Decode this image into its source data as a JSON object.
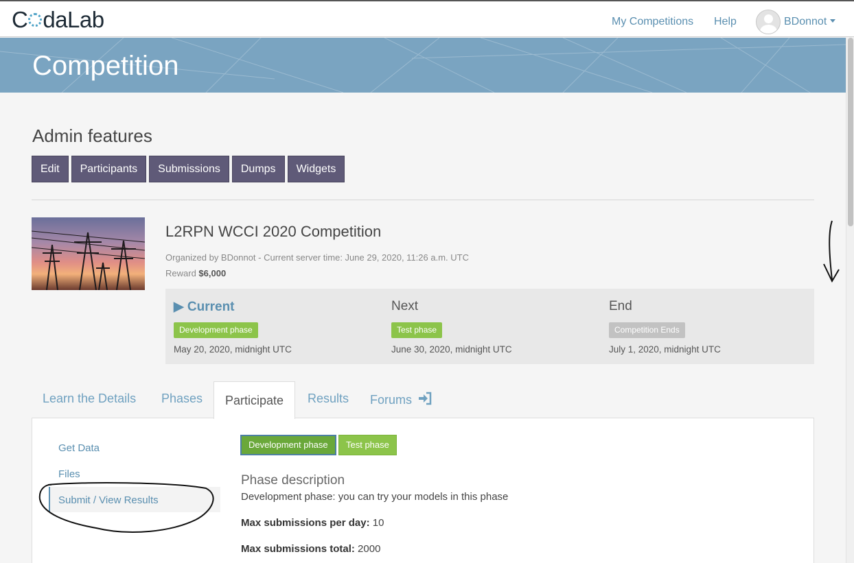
{
  "topbar": {
    "logo_text_a": "C",
    "logo_text_b": "daLab",
    "nav_my_competitions": "My Competitions",
    "nav_help": "Help",
    "nav_user": "BDonnot"
  },
  "banner": {
    "title": "Competition"
  },
  "admin": {
    "title": "Admin features",
    "buttons": [
      "Edit",
      "Participants",
      "Submissions",
      "Dumps",
      "Widgets"
    ]
  },
  "competition": {
    "title": "L2RPN WCCI 2020 Competition",
    "meta": "Organized by BDonnot - Current server time: June 29, 2020, 11:26 a.m. UTC",
    "reward_label": "Reward",
    "reward_value": "$6,000",
    "phases": [
      {
        "head": "Current",
        "label": "Development phase",
        "date": "May 20, 2020, midnight UTC"
      },
      {
        "head": "Next",
        "label": "Test phase",
        "date": "June 30, 2020, midnight UTC"
      },
      {
        "head": "End",
        "label": "Competition Ends",
        "date": "July 1, 2020, midnight UTC"
      }
    ]
  },
  "tabs": [
    "Learn the Details",
    "Phases",
    "Participate",
    "Results",
    "Forums"
  ],
  "active_tab": "Participate",
  "participate": {
    "side_links": [
      "Get Data",
      "Files",
      "Submit / View Results"
    ],
    "phase_buttons": [
      "Development phase",
      "Test phase"
    ],
    "description_title": "Phase description",
    "description_text": "Development phase: you can try your models in this phase",
    "max_per_day_label": "Max submissions per day:",
    "max_per_day_value": "10",
    "max_total_label": "Max submissions total:",
    "max_total_value": "2000"
  },
  "colors": {
    "accent": "#5a8fb0",
    "banner": "#7aa4c1",
    "admin_button": "#5f5a78",
    "phase_green": "#8cc44a",
    "phase_grey": "#c2c2c2"
  }
}
